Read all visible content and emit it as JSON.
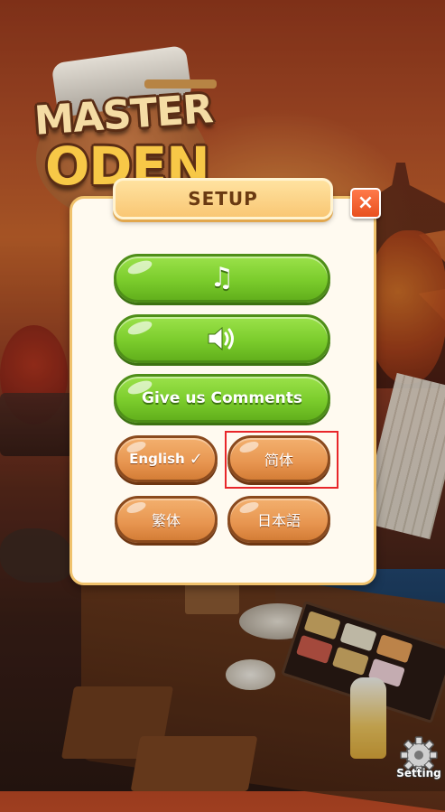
{
  "game": {
    "logo_line1": "MASTER",
    "logo_line2": "ODEN"
  },
  "dialog": {
    "title": "SETUP",
    "close_icon": "×",
    "music_icon": "♫",
    "sound_icon": "🔊",
    "comments_label": "Give us Comments"
  },
  "languages": {
    "english": "English",
    "english_check": "✓",
    "simplified_chinese": "简体",
    "traditional_chinese": "繁体",
    "japanese": "日本語",
    "selected": "简体"
  },
  "corner": {
    "setting_label": "Setting"
  },
  "colors": {
    "green_button": "#7bcc2c",
    "orange_button": "#e79550",
    "title_tab": "#f9c774",
    "close_button": "#e8501f",
    "selection_outline": "#e8262a"
  }
}
